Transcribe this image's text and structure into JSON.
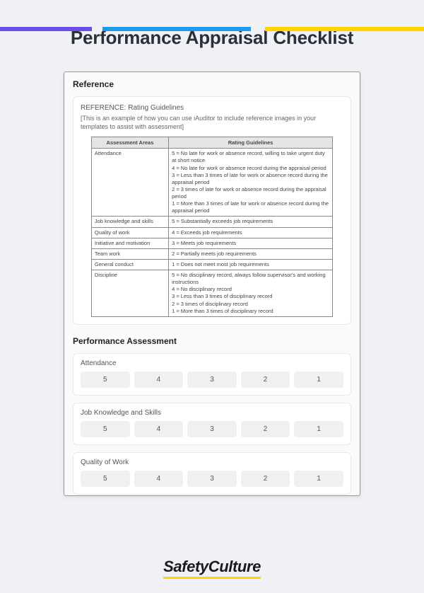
{
  "topbar": {
    "colors": [
      "#6b4de6",
      "#1b9aee",
      "#ffd500"
    ]
  },
  "title": "Performance Appraisal Checklist",
  "reference": {
    "section_header": "Reference",
    "title": "REFERENCE: Rating Guidelines",
    "subtitle": "[This is an example of how you can use iAuditor to include reference images in your templates to assist with assessment]",
    "table": {
      "col1": "Assessment Areas",
      "col2": "Rating Guidelines",
      "rows": [
        {
          "area": "Attendance",
          "guidelines": [
            "5 = No late for work or absence record, willing to take urgent duty at short notice",
            "4 = No late for work or absence record during the appraisal period",
            "3 = Less than 3 times of late for work or absence record during the appraisal period",
            "2 = 3 times of late for work or absence record during the appraisal period",
            "1 = More than 3 times of late for work or absence record during the appraisal period"
          ]
        },
        {
          "area": "Job knowledge and skills",
          "guidelines": [
            "5 = Substantially exceeds job requirements"
          ]
        },
        {
          "area": "Quality of work",
          "guidelines": [
            "4 = Exceeds job requirements"
          ]
        },
        {
          "area": "Initiative and motivation",
          "guidelines": [
            "3 = Meets job requirements"
          ]
        },
        {
          "area": "Team work",
          "guidelines": [
            "2 = Partially meets job requirements"
          ]
        },
        {
          "area": "General conduct",
          "guidelines": [
            "1 = Does not meet most job requirements"
          ]
        },
        {
          "area": "Discipline",
          "guidelines": [
            "5 = No disciplinary record, always follow supervisor's and working instructions",
            "4 = No disciplinary record",
            "3 = Less than 3 times of disciplinary record",
            "2 = 3 times of disciplinary record",
            "1 = More than 3 times of disciplinary record"
          ]
        }
      ]
    }
  },
  "assessment": {
    "section_header": "Performance Assessment",
    "items": [
      {
        "label": "Attendance",
        "options": [
          "5",
          "4",
          "3",
          "2",
          "1"
        ]
      },
      {
        "label": "Job Knowledge and Skills",
        "options": [
          "5",
          "4",
          "3",
          "2",
          "1"
        ]
      },
      {
        "label": "Quality of Work",
        "options": [
          "5",
          "4",
          "3",
          "2",
          "1"
        ]
      }
    ]
  },
  "footer": {
    "brand": "SafetyCulture"
  }
}
